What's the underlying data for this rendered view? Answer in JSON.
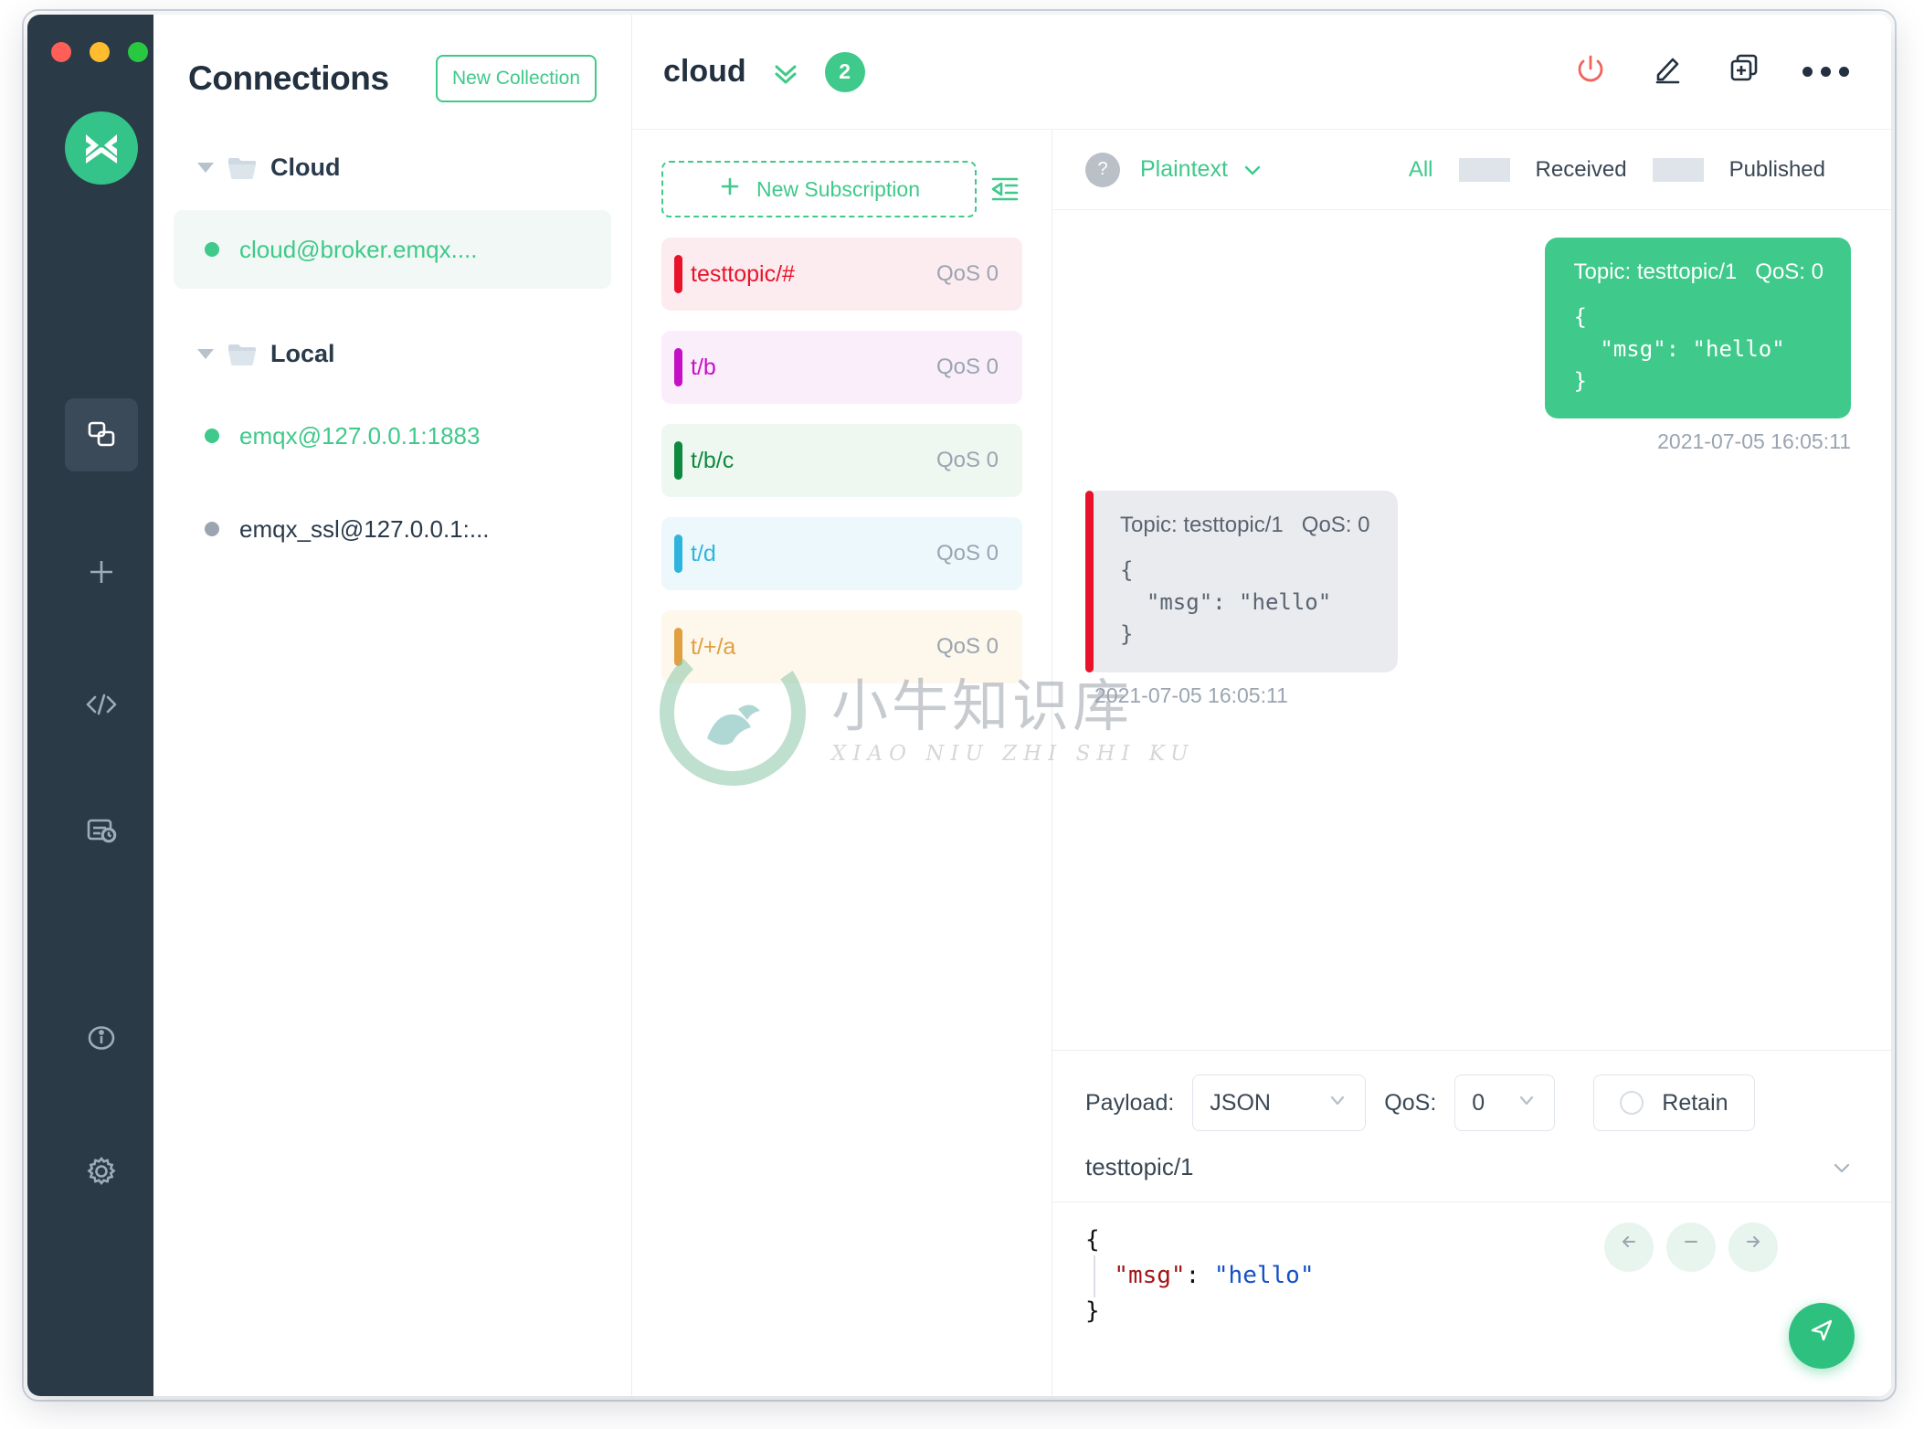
{
  "window": {
    "traffic_lights": [
      "close",
      "minimize",
      "maximize"
    ],
    "colors": {
      "accent": "#3fc98a",
      "dark_rail": "#2a3a47",
      "danger": "#f1635c"
    }
  },
  "rail": {
    "logo_name": "mqttx-logo",
    "items": [
      {
        "name": "connections-icon",
        "active": true
      },
      {
        "name": "new-connection-icon",
        "active": false
      },
      {
        "name": "script-code-icon",
        "active": false
      },
      {
        "name": "log-history-icon",
        "active": false
      },
      {
        "name": "about-info-icon",
        "active": false
      },
      {
        "name": "settings-gear-icon",
        "active": false
      }
    ]
  },
  "connections": {
    "title": "Connections",
    "new_collection_label": "New Collection",
    "groups": [
      {
        "label": "Cloud",
        "expanded": true,
        "items": [
          {
            "name": "cloud@broker.emqx....",
            "status": "connected",
            "selected": true
          }
        ]
      },
      {
        "label": "Local",
        "expanded": true,
        "items": [
          {
            "name": "emqx@127.0.0.1:1883",
            "status": "connected",
            "selected": false
          },
          {
            "name": "emqx_ssl@127.0.0.1:...",
            "status": "disconnected",
            "selected": false
          }
        ]
      }
    ]
  },
  "topbar": {
    "title": "cloud",
    "badge": "2",
    "icons": [
      {
        "name": "power-icon",
        "color": "#f1635c"
      },
      {
        "name": "edit-pencil-icon",
        "color": "#22303f"
      },
      {
        "name": "new-window-icon",
        "color": "#22303f"
      },
      {
        "name": "more-options-icon",
        "color": "#22303f"
      }
    ]
  },
  "subscriptions": {
    "new_subscription_label": "New Subscription",
    "collapse_icon": "collapse-left-icon",
    "items": [
      {
        "topic": "testtopic/#",
        "qos": "QoS 0",
        "color": "#e8132b",
        "bg": "#fdecef"
      },
      {
        "topic": "t/b",
        "qos": "QoS 0",
        "color": "#c511c5",
        "bg": "#fbeefb"
      },
      {
        "topic": "t/b/c",
        "qos": "QoS 0",
        "color": "#0e8a3e",
        "bg": "#eff7f1"
      },
      {
        "topic": "t/d",
        "qos": "QoS 0",
        "color": "#2fb5dd",
        "bg": "#ecf8fc"
      },
      {
        "topic": "t/+/a",
        "qos": "QoS 0",
        "color": "#e0a040",
        "bg": "#fdf7ec"
      }
    ]
  },
  "messages_toolbar": {
    "help_icon": "?",
    "format": "Plaintext",
    "filters": [
      {
        "label": "All",
        "active": true
      },
      {
        "label": "Received",
        "active": false
      },
      {
        "label": "Published",
        "active": false
      }
    ]
  },
  "messages": [
    {
      "direction": "published",
      "topic_label": "Topic: testtopic/1",
      "qos_label": "QoS: 0",
      "payload": "{\n  \"msg\": \"hello\"\n}",
      "time": "2021-07-05 16:05:11"
    },
    {
      "direction": "received",
      "topic_label": "Topic: testtopic/1",
      "qos_label": "QoS: 0",
      "payload": "{\n  \"msg\": \"hello\"\n}",
      "time": "2021-07-05 16:05:11",
      "bar_color": "#e8132b"
    }
  ],
  "publish": {
    "payload_label": "Payload:",
    "payload_value": "JSON",
    "qos_label": "QoS:",
    "qos_value": "0",
    "retain_label": "Retain",
    "retain_checked": false,
    "topic": "testtopic/1",
    "editor": {
      "line1": "{",
      "key": "\"msg\"",
      "colon": ": ",
      "value": "\"hello\"",
      "line3": "}"
    },
    "buttons": [
      {
        "name": "editor-back-icon"
      },
      {
        "name": "editor-minus-icon"
      },
      {
        "name": "editor-forward-icon"
      }
    ],
    "send_icon": "send-icon"
  },
  "watermark": {
    "cn": "小牛知识库",
    "en": "XIAO NIU ZHI SHI KU"
  }
}
